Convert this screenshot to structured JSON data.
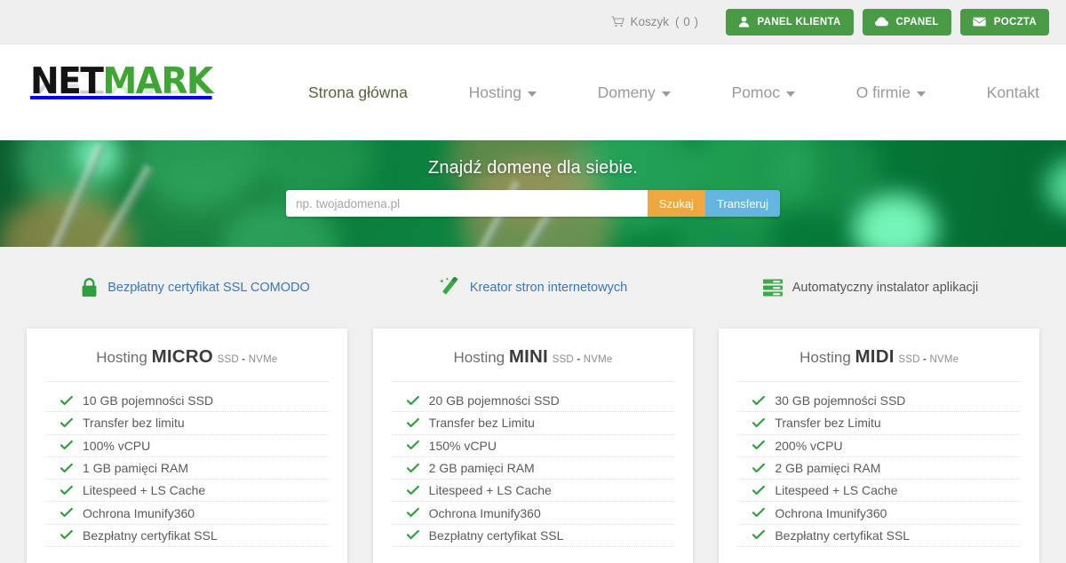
{
  "topbar": {
    "cart_label": "Koszyk",
    "cart_count": "( 0 )",
    "cart_icon": "shopping-cart-icon",
    "buttons": [
      {
        "label": "PANEL KLIENTA",
        "icon": "user-icon"
      },
      {
        "label": "CPANEL",
        "icon": "cloud-icon"
      },
      {
        "label": "POCZTA",
        "icon": "envelope-icon"
      }
    ],
    "button_color": "#4a9b46"
  },
  "header": {
    "logo": {
      "part1": "NET",
      "part2": "MARK",
      "color1": "#141414",
      "color2": "#3fa535"
    },
    "nav": [
      {
        "label": "Strona główna",
        "dropdown": false,
        "active": true
      },
      {
        "label": "Hosting",
        "dropdown": true,
        "active": false
      },
      {
        "label": "Domeny",
        "dropdown": true,
        "active": false
      },
      {
        "label": "Pomoc",
        "dropdown": true,
        "active": false
      },
      {
        "label": "O firmie",
        "dropdown": true,
        "active": false
      },
      {
        "label": "Kontakt",
        "dropdown": false,
        "active": false
      }
    ],
    "active_color": "#55633a",
    "inactive_color": "#9a9a9a"
  },
  "hero": {
    "title": "Znajdź domenę dla siebie.",
    "search_placeholder": "np. twojadomena.pl",
    "search_value": "",
    "search_button": "Szukaj",
    "transfer_button": "Transferuj",
    "search_button_color": "#efa73f",
    "transfer_button_color": "#66b5e0",
    "background": "green fiber-optic bokeh"
  },
  "features": [
    {
      "label": "Bezpłatny certyfikat SSL COMODO",
      "icon": "padlock-icon",
      "link": true
    },
    {
      "label": "Kreator stron internetowych",
      "icon": "magic-wand-icon",
      "link": true
    },
    {
      "label": "Automatyczny instalator aplikacji",
      "icon": "server-stack-icon",
      "link": false
    }
  ],
  "plans": [
    {
      "prefix": "Hosting",
      "name": "MICRO",
      "tech_left": "SSD",
      "tech_sep": "-",
      "tech_right": "NVMe",
      "features": [
        "10 GB pojemności SSD",
        "Transfer bez limitu",
        "100% vCPU",
        "1 GB pamięci RAM",
        "Litespeed + LS Cache",
        "Ochrona Imunify360",
        "Bezpłatny certyfikat SSL"
      ]
    },
    {
      "prefix": "Hosting",
      "name": "MINI",
      "tech_left": "SSD",
      "tech_sep": "-",
      "tech_right": "NVMe",
      "features": [
        "20 GB pojemności SSD",
        "Transfer bez Limitu",
        "150% vCPU",
        "2 GB pamięci RAM",
        "Litespeed + LS Cache",
        "Ochrona Imunify360",
        "Bezpłatny certyfikat SSL"
      ]
    },
    {
      "prefix": "Hosting",
      "name": "MIDI",
      "tech_left": "SSD",
      "tech_sep": "-",
      "tech_right": "NVMe",
      "features": [
        "30 GB pojemności SSD",
        "Transfer bez Limitu",
        "200% vCPU",
        "2 GB pamięci RAM",
        "Litespeed + LS Cache",
        "Ochrona Imunify360",
        "Bezpłatny certyfikat SSL"
      ]
    }
  ]
}
